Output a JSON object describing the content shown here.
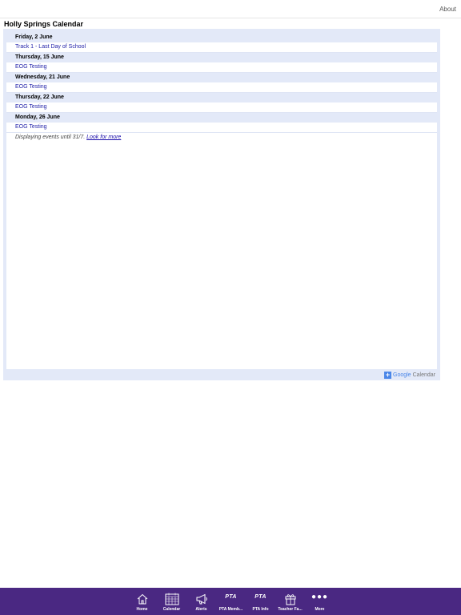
{
  "header": {
    "about_label": "About"
  },
  "page": {
    "title": "Holly Springs Calendar"
  },
  "calendar": {
    "days": [
      {
        "date": "Friday, 2 June",
        "events": [
          "Track 1 - Last Day of School"
        ]
      },
      {
        "date": "Thursday, 15 June",
        "events": [
          "EOG Testing"
        ]
      },
      {
        "date": "Wednesday, 21 June",
        "events": [
          "EOG Testing"
        ]
      },
      {
        "date": "Thursday, 22 June",
        "events": [
          "EOG Testing"
        ]
      },
      {
        "date": "Monday, 26 June",
        "events": [
          "EOG Testing"
        ]
      }
    ],
    "footer_text": "Displaying events until 31/7.",
    "footer_link": "Look for more",
    "badge_google": "Google",
    "badge_calendar": "Calendar"
  },
  "tabbar": {
    "items": [
      {
        "label": "Home",
        "icon": "home-icon"
      },
      {
        "label": "Calendar",
        "icon": "calendar-icon"
      },
      {
        "label": "Alerts",
        "icon": "megaphone-icon"
      },
      {
        "label": "PTA Memb...",
        "icon": "pta-icon",
        "glyph": "PTA"
      },
      {
        "label": "PTA Info",
        "icon": "pta-icon",
        "glyph": "PTA"
      },
      {
        "label": "Teacher Fa...",
        "icon": "gift-icon"
      },
      {
        "label": "More",
        "icon": "more-icon",
        "glyph": "●●●"
      }
    ],
    "color": "#4a2882"
  },
  "colors": {
    "frame": "#e3e9f8",
    "event_text": "#2222aa"
  }
}
